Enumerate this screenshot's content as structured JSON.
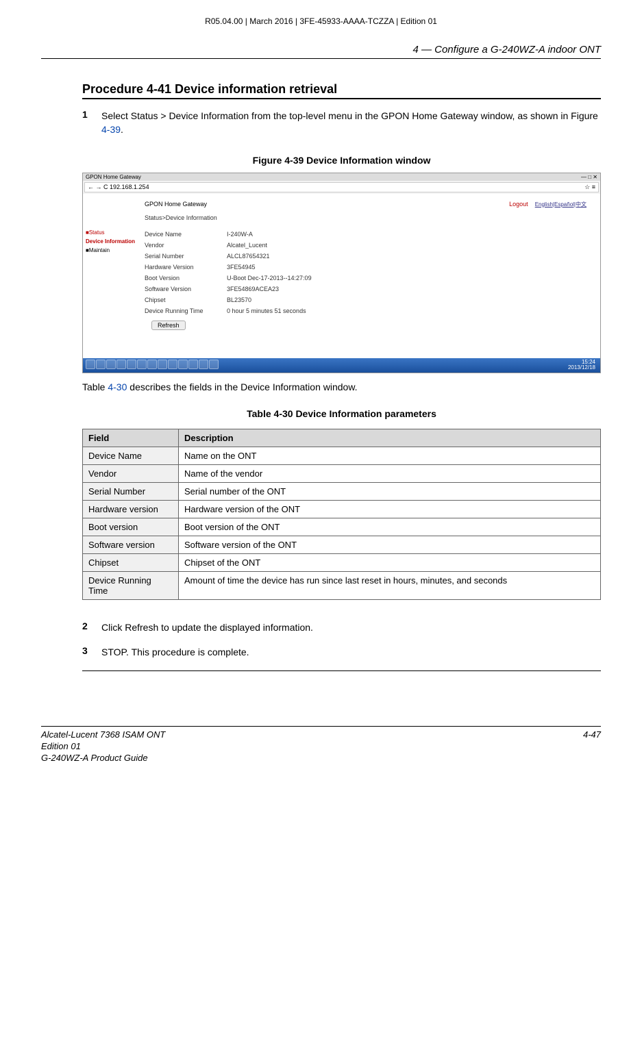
{
  "doc_id": "R05.04.00 | March 2016 | 3FE-45933-AAAA-TCZZA | Edition 01",
  "chapter": "4 —  Configure a G-240WZ-A indoor ONT",
  "proc_title": "Procedure 4-41  Device information retrieval",
  "steps": {
    "s1_num": "1",
    "s1_body_a": "Select Status > Device Information from the top-level menu in the GPON Home Gateway window, as shown in Figure ",
    "s1_link": "4-39",
    "s1_body_b": ".",
    "s2_num": "2",
    "s2_body": "Click Refresh to update the displayed information.",
    "s3_num": "3",
    "s3_body": "STOP. This procedure is complete."
  },
  "fig_caption": "Figure 4-39  Device Information window",
  "browser": {
    "tab": "GPON Home Gateway",
    "url": "192.168.1.254",
    "star": "☆",
    "menu": "≡",
    "header_title": "GPON Home Gateway",
    "logout": "Logout",
    "lang": "English|Español|中文",
    "breadcrumb": "Status>Device Information",
    "sidebar": {
      "status": "Status",
      "devinfo": "Device Information",
      "maintain": "Maintain"
    },
    "info": [
      {
        "label": "Device Name",
        "value": "I-240W-A"
      },
      {
        "label": "Vendor",
        "value": "Alcatel_Lucent"
      },
      {
        "label": "Serial Number",
        "value": "ALCL87654321"
      },
      {
        "label": "Hardware Version",
        "value": "3FE54945"
      },
      {
        "label": "Boot Version",
        "value": "U-Boot Dec-17-2013--14:27:09"
      },
      {
        "label": "Software Version",
        "value": "3FE54869ACEA23"
      },
      {
        "label": "Chipset",
        "value": "BL23570"
      },
      {
        "label": "Device Running Time",
        "value": "0 hour 5 minutes 51 seconds"
      }
    ],
    "refresh": "Refresh",
    "clock_time": "15:24",
    "clock_date": "2013/12/18"
  },
  "desc_text_a": "Table ",
  "desc_link": "4-30",
  "desc_text_b": " describes the fields in the Device Information window.",
  "table_caption": "Table 4-30 Device Information parameters",
  "table": {
    "h1": "Field",
    "h2": "Description",
    "rows": [
      {
        "f": "Device Name",
        "d": "Name on the ONT"
      },
      {
        "f": "Vendor",
        "d": "Name of the vendor"
      },
      {
        "f": "Serial Number",
        "d": "Serial number of the ONT"
      },
      {
        "f": "Hardware version",
        "d": "Hardware version of the ONT"
      },
      {
        "f": "Boot version",
        "d": "Boot version of the ONT"
      },
      {
        "f": "Software version",
        "d": "Software version of the ONT"
      },
      {
        "f": "Chipset",
        "d": "Chipset of the ONT"
      },
      {
        "f": "Device Running Time",
        "d": "Amount of time the device has run since last reset in hours, minutes, and seconds"
      }
    ]
  },
  "footer": {
    "l1": "Alcatel-Lucent 7368 ISAM ONT",
    "l2": "Edition 01",
    "l3": "G-240WZ-A Product Guide",
    "page": "4-47"
  }
}
